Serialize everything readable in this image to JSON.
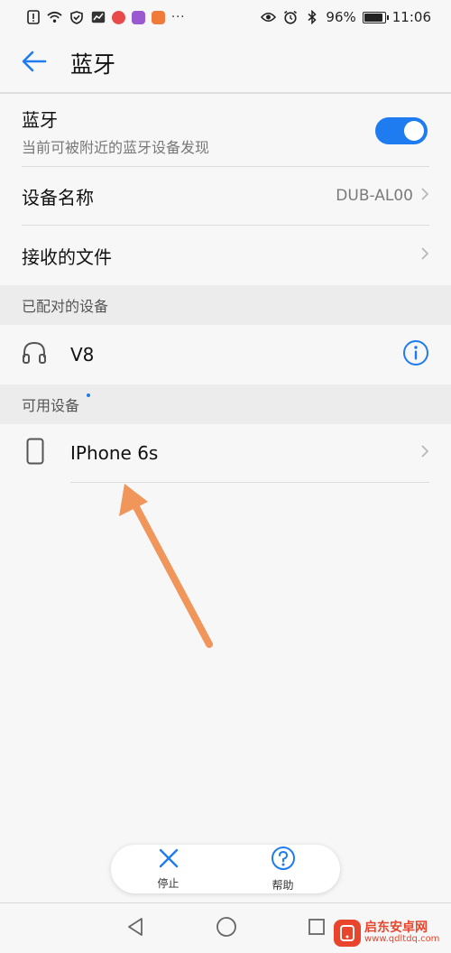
{
  "status_bar": {
    "battery_percent": "96%",
    "battery_level": 0.96,
    "time": "11:06",
    "more_indicator": "···",
    "icons_left": [
      "alert-card-icon",
      "wifi-icon",
      "shield-icon",
      "chart-icon",
      "app-icon-red",
      "app-icon-purple",
      "app-icon-orange"
    ],
    "icons_right": [
      "eye-icon",
      "alarm-icon",
      "bluetooth-icon"
    ]
  },
  "header": {
    "title": "蓝牙"
  },
  "bluetooth_row": {
    "label": "蓝牙",
    "subtitle": "当前可被附近的蓝牙设备发现",
    "enabled": true
  },
  "device_name_row": {
    "label": "设备名称",
    "value": "DUB-AL00"
  },
  "received_files_row": {
    "label": "接收的文件"
  },
  "paired_section": {
    "header": "已配对的设备",
    "devices": [
      {
        "name": "V8",
        "icon": "headphones-icon"
      }
    ]
  },
  "available_section": {
    "header": "可用设备",
    "devices": [
      {
        "name": "IPhone 6s",
        "icon": "phone-icon"
      }
    ]
  },
  "bottom_actions": {
    "stop_label": "停止",
    "help_label": "帮助"
  },
  "watermark": {
    "title": "启东安卓网",
    "url": "www.qdltdq.com"
  },
  "colors": {
    "accent": "#1e7cf0",
    "annotation_arrow": "#f0965a",
    "section_bg": "#ececec",
    "page_bg": "#f7f7f7"
  }
}
